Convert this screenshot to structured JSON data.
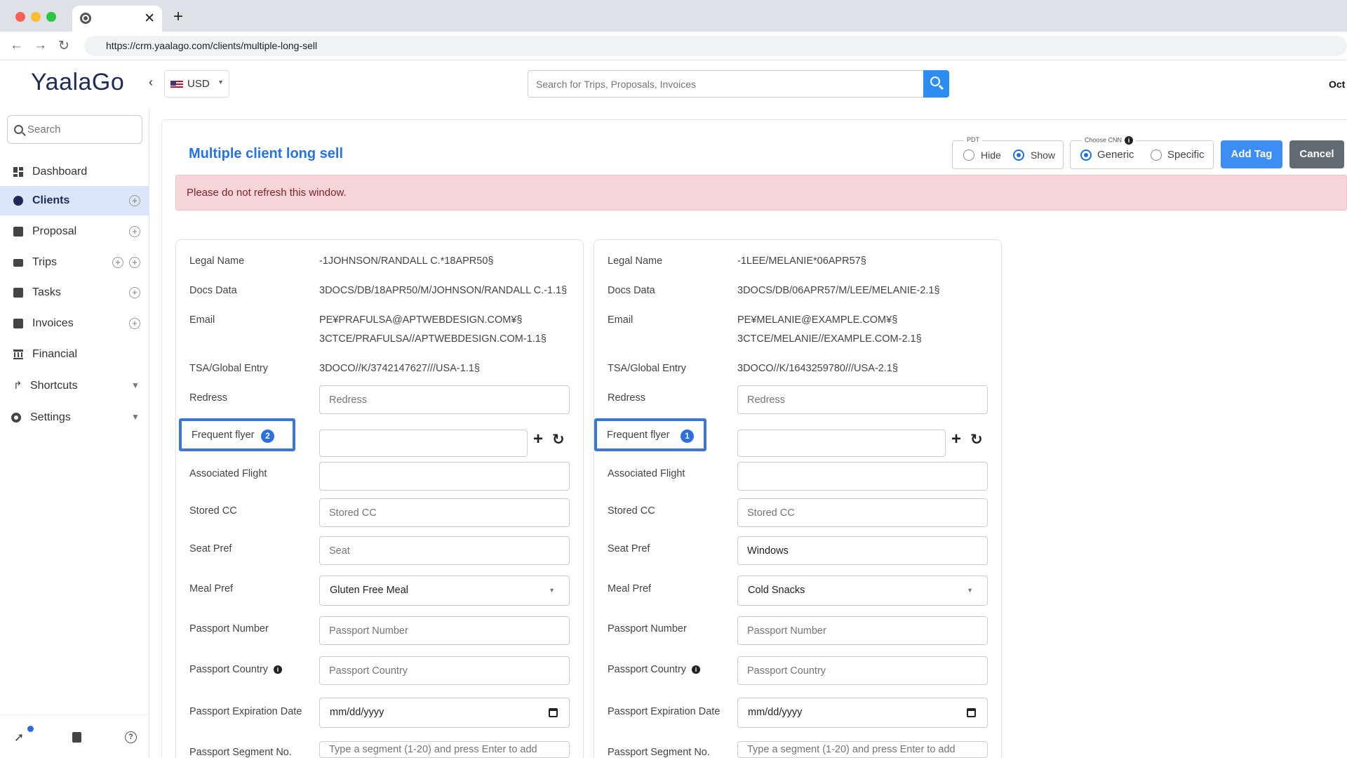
{
  "browser": {
    "url": "https://crm.yaalago.com/clients/multiple-long-sell",
    "new_tab_symbol": "+",
    "close_tab_symbol": "✕"
  },
  "app": {
    "logo": "YaalaGo",
    "currency": "USD",
    "search_placeholder": "Search for Trips, Proposals, Invoices",
    "date_fragment": "Oct"
  },
  "sidebar": {
    "search_placeholder": "Search",
    "items": [
      {
        "label": "Dashboard"
      },
      {
        "label": "Clients"
      },
      {
        "label": "Proposal"
      },
      {
        "label": "Trips"
      },
      {
        "label": "Tasks"
      },
      {
        "label": "Invoices"
      },
      {
        "label": "Financial"
      },
      {
        "label": "Shortcuts"
      },
      {
        "label": "Settings"
      }
    ]
  },
  "page": {
    "title": "Multiple client long sell",
    "pdt_legend": "PDT",
    "pdt_options": [
      "Hide",
      "Show"
    ],
    "pdt_selected": "Show",
    "cnn_legend": "Choose CNN",
    "cnn_options": [
      "Generic",
      "Specific"
    ],
    "cnn_selected": "Generic",
    "add_tag_label": "Add Tag",
    "cancel_label": "Cancel",
    "alert": "Please do not refresh this window."
  },
  "labels": {
    "legal_name": "Legal Name",
    "docs_data": "Docs Data",
    "email": "Email",
    "tsa": "TSA/Global Entry",
    "redress": "Redress",
    "frequent_flyer": "Frequent flyer",
    "associated_flight": "Associated Flight",
    "stored_cc": "Stored CC",
    "seat_pref": "Seat Pref",
    "meal_pref": "Meal Pref",
    "passport_number": "Passport Number",
    "passport_country": "Passport Country",
    "passport_expiration": "Passport Expiration Date",
    "passport_segment": "Passport Segment No."
  },
  "placeholders": {
    "redress": "Redress",
    "stored_cc": "Stored CC",
    "seat": "Seat",
    "passport_number": "Passport Number",
    "passport_country": "Passport Country",
    "date": "mm/dd/yyyy",
    "segment": "Type a segment (1-20) and press Enter to add"
  },
  "clients": [
    {
      "legal_name": "-1JOHNSON/RANDALL C.*18APR50§",
      "docs_data": "3DOCS/DB/18APR50/M/JOHNSON/RANDALL C.-1.1§",
      "email_line1": "PE¥PRAFULSA@APTWEBDESIGN.COM¥§",
      "email_line2": "3CTCE/PRAFULSA//APTWEBDESIGN.COM-1.1§",
      "tsa": "3DOCO//K/3742147627///USA-1.1§",
      "frequent_flyer_count": "2",
      "seat_pref": "",
      "meal_pref": "Gluten Free Meal"
    },
    {
      "legal_name": "-1LEE/MELANIE*06APR57§",
      "docs_data": "3DOCS/DB/06APR57/M/LEE/MELANIE-2.1§",
      "email_line1": "PE¥MELANIE@EXAMPLE.COM¥§",
      "email_line2": "3CTCE/MELANIE//EXAMPLE.COM-2.1§",
      "tsa": "3DOCO//K/1643259780///USA-2.1§",
      "frequent_flyer_count": "1",
      "seat_pref": "Windows",
      "meal_pref": "Cold Snacks"
    }
  ],
  "colors": {
    "accent": "#2872e8",
    "alert_bg": "#f7d6da",
    "highlight_border": "#3a78d8"
  }
}
